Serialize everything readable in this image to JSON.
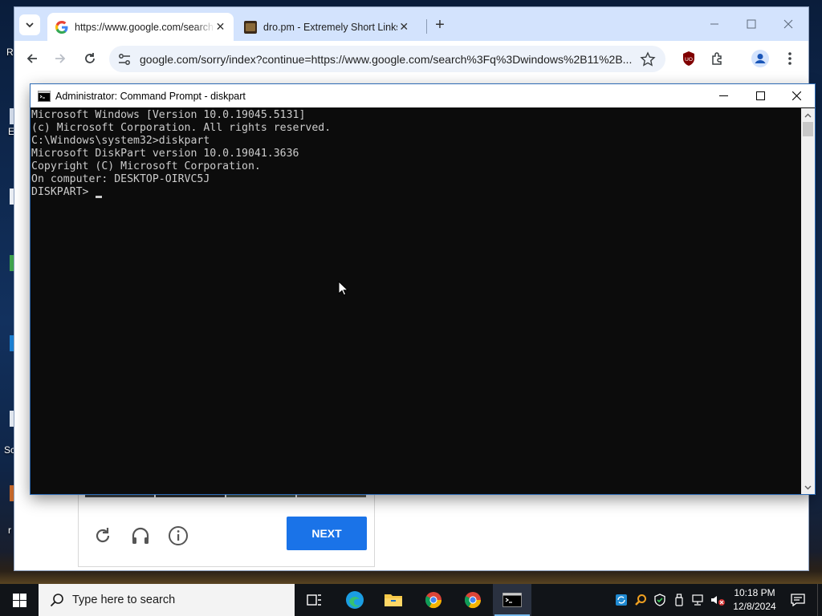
{
  "desktop": {
    "fragments": [
      "R",
      "E",
      "Sc",
      "r"
    ]
  },
  "browser": {
    "tabs": [
      {
        "title": "https://www.google.com/search?q=windows",
        "close": "✕",
        "active": true
      },
      {
        "title": "dro.pm - Extremely Short Links",
        "close": "✕",
        "active": false
      }
    ],
    "new_tab": "+",
    "window_controls": {
      "minimize": "—",
      "maximize": "☐",
      "close": "✕"
    },
    "address": "google.com/sorry/index?continue=https://www.google.com/search%3Fq%3Dwindows%2B11%2B...",
    "captcha": {
      "next_label": "NEXT"
    }
  },
  "cmd": {
    "title": "Administrator: Command Prompt - diskpart",
    "lines": [
      "Microsoft Windows [Version 10.0.19045.5131]",
      "(c) Microsoft Corporation. All rights reserved.",
      "",
      "C:\\Windows\\system32>diskpart",
      "",
      "Microsoft DiskPart version 10.0.19041.3636",
      "",
      "Copyright (C) Microsoft Corporation.",
      "On computer: DESKTOP-OIRVC5J",
      ""
    ],
    "prompt": "DISKPART> "
  },
  "taskbar": {
    "search_placeholder": "Type here to search",
    "apps": [
      "task-view",
      "edge",
      "file-explorer",
      "chrome",
      "chrome",
      "command-prompt"
    ],
    "time": "10:18 PM",
    "date": "12/8/2024"
  },
  "colors": {
    "chrome_tabstrip": "#d3e3fd",
    "omnibox": "#edf2fa",
    "next_button": "#1a73e8",
    "console_bg": "#0c0c0c",
    "console_fg": "#cccccc",
    "taskbar": "#111418"
  }
}
